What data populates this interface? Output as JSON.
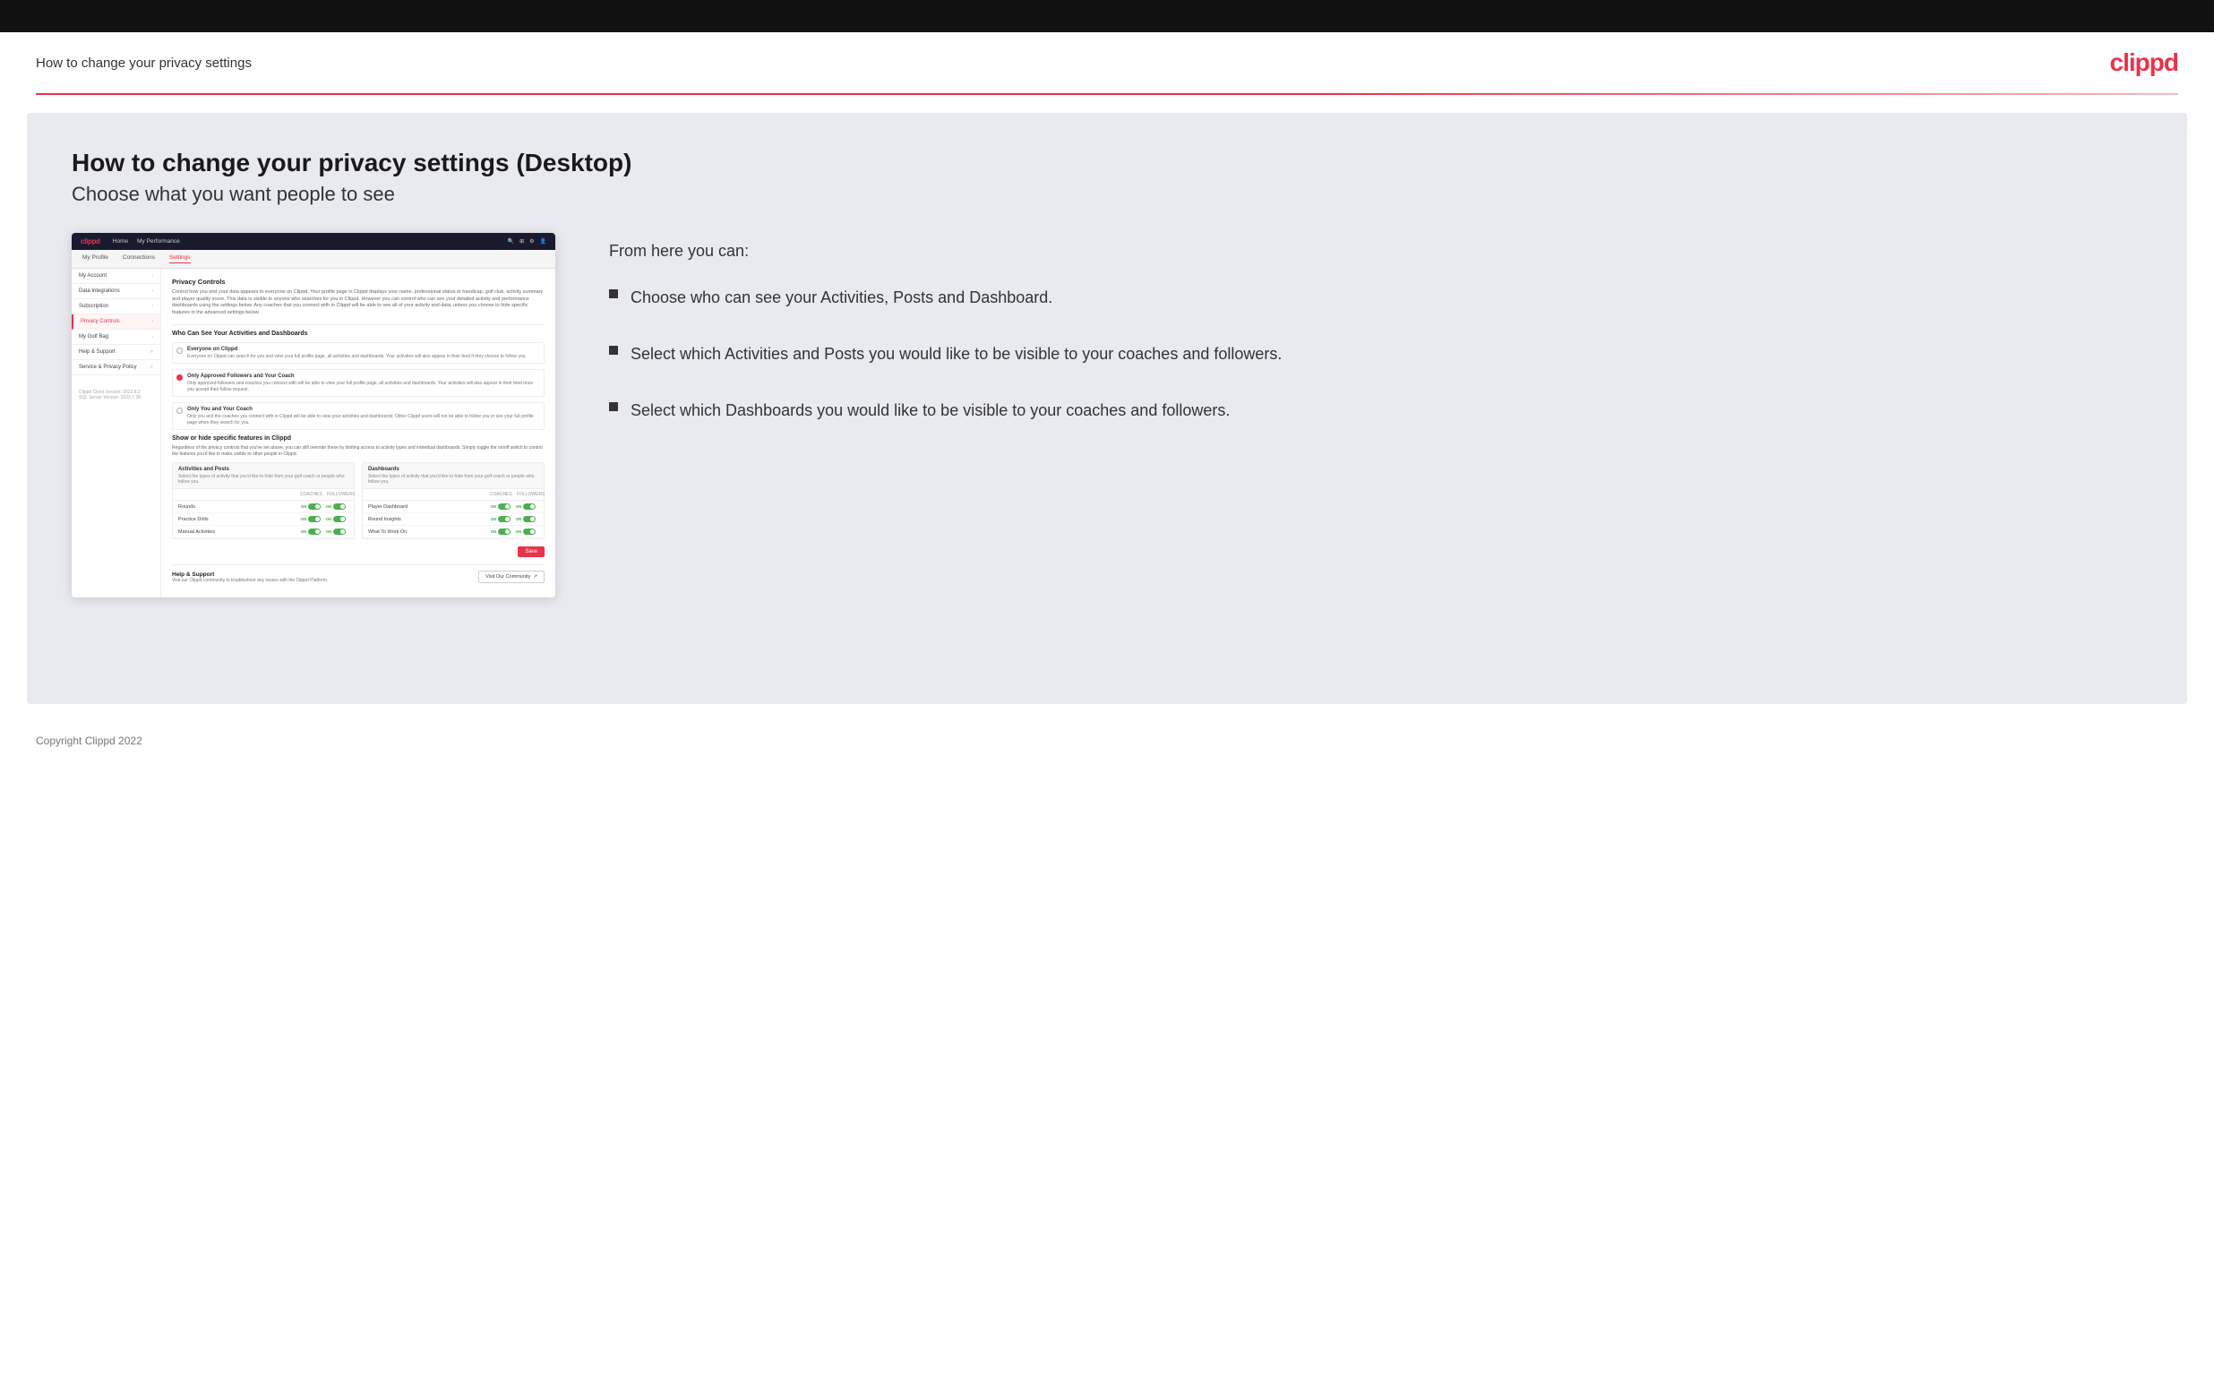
{
  "topBar": {},
  "header": {
    "title": "How to change your privacy settings",
    "logo": "clippd"
  },
  "main": {
    "contentTitle": "How to change your privacy settings (Desktop)",
    "contentSubtitle": "Choose what you want people to see",
    "rightPanel": {
      "intro": "From here you can:",
      "bullets": [
        "Choose who can see your Activities, Posts and Dashboard.",
        "Select which Activities and Posts you would like to be visible to your coaches and followers.",
        "Select which Dashboards you would like to be visible to your coaches and followers."
      ]
    }
  },
  "mockup": {
    "nav": {
      "logo": "clippd",
      "links": [
        "Home",
        "My Performance"
      ],
      "icons": [
        "🔍",
        "⊞",
        "⚙",
        "👤"
      ]
    },
    "subnav": [
      "My Profile",
      "Connections",
      "Settings"
    ],
    "subnavActive": "Settings",
    "sidebar": {
      "items": [
        {
          "label": "My Account",
          "hasChevron": true
        },
        {
          "label": "Data Integrations",
          "hasChevron": true
        },
        {
          "label": "Subscription",
          "hasChevron": true
        },
        {
          "label": "Privacy Controls",
          "hasChevron": true,
          "active": true
        },
        {
          "label": "My Golf Bag",
          "hasChevron": true
        },
        {
          "label": "Help & Support",
          "hasChevron": false,
          "external": true
        },
        {
          "label": "Service & Privacy Policy",
          "hasChevron": false,
          "external": true
        }
      ],
      "version": "Clippd Client Version: 2022.8.2\nSQL Server Version: 2022.7.38"
    },
    "main": {
      "sectionTitle": "Privacy Controls",
      "sectionDesc": "Control how you and your data appears to everyone on Clippd. Your profile page in Clippd displays your name, professional status or handicap, golf club, activity summary and player quality score. This data is visible to anyone who searches for you in Clippd. However you can control who can see your detailed activity and performance dashboards using the settings below. Any coaches that you connect with in Clippd will be able to see all of your activity and data, unless you choose to hide specific features in the advanced settings below.",
      "whoTitle": "Who Can See Your Activities and Dashboards",
      "radioOptions": [
        {
          "label": "Everyone on Clippd",
          "desc": "Everyone on Clippd can search for you and view your full profile page, all activities and dashboards. Your activities will also appear in their feed if they choose to follow you.",
          "selected": false
        },
        {
          "label": "Only Approved Followers and Your Coach",
          "desc": "Only approved followers and coaches you connect with will be able to view your full profile page, all activities and dashboards. Your activities will also appear in their feed once you accept their follow request.",
          "selected": true
        },
        {
          "label": "Only You and Your Coach",
          "desc": "Only you and the coaches you connect with in Clippd will be able to view your activities and dashboards. Other Clippd users will not be able to follow you or see your full profile page when they search for you.",
          "selected": false
        }
      ],
      "showHideTitle": "Show or hide specific features in Clippd",
      "showHideDesc": "Regardless of the privacy controls that you've set above, you can still override these by limiting access to activity types and individual dashboards. Simply toggle the on/off switch to control the features you'd like to make visible to other people in Clippd.",
      "activitiesTable": {
        "title": "Activities and Posts",
        "desc": "Select the types of activity that you'd like to hide from your golf coach or people who follow you.",
        "colHeaders": [
          "COACHES",
          "FOLLOWERS"
        ],
        "rows": [
          {
            "label": "Rounds",
            "coachOn": true,
            "followerOn": true
          },
          {
            "label": "Practice Drills",
            "coachOn": true,
            "followerOn": true
          },
          {
            "label": "Manual Activities",
            "coachOn": true,
            "followerOn": true
          }
        ]
      },
      "dashboardsTable": {
        "title": "Dashboards",
        "desc": "Select the types of activity that you'd like to hide from your golf coach or people who follow you.",
        "colHeaders": [
          "COACHES",
          "FOLLOWERS"
        ],
        "rows": [
          {
            "label": "Player Dashboard",
            "coachOn": true,
            "followerOn": true
          },
          {
            "label": "Round Insights",
            "coachOn": true,
            "followerOn": true
          },
          {
            "label": "What To Work On",
            "coachOn": true,
            "followerOn": true
          }
        ]
      },
      "saveButton": "Save",
      "helpSection": {
        "title": "Help & Support",
        "desc": "Visit our Clippd community to troubleshoot any issues with the Clippd Platform.",
        "buttonLabel": "Visit Our Community"
      }
    }
  },
  "footer": {
    "copyright": "Copyright Clippd 2022"
  }
}
